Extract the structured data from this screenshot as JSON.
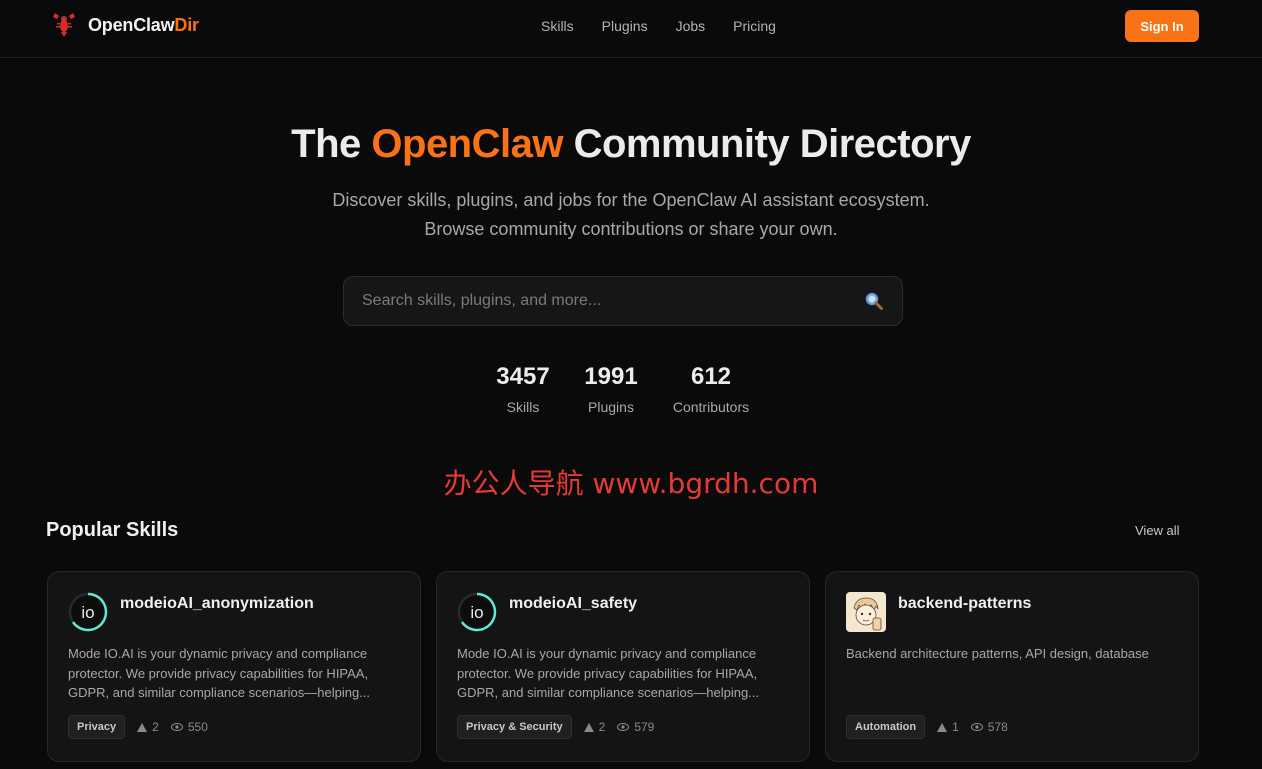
{
  "nav": {
    "brand_main": "OpenClaw",
    "brand_accent": "Dir",
    "brand_icon": "lobster-icon",
    "links": [
      "Skills",
      "Plugins",
      "Jobs",
      "Pricing"
    ],
    "signin_label": "Sign In"
  },
  "hero": {
    "title_prefix": "The ",
    "title_accent": "OpenClaw",
    "title_suffix": " Community Directory",
    "subtitle": "Discover skills, plugins, and jobs for the OpenClaw AI assistant ecosystem. Browse community contributions or share your own."
  },
  "search": {
    "placeholder": "Search skills, plugins, and more...",
    "value": "",
    "icon": "search-icon"
  },
  "stats": [
    {
      "value": "3457",
      "label": "Skills"
    },
    {
      "value": "1991",
      "label": "Plugins"
    },
    {
      "value": "612",
      "label": "Contributors"
    }
  ],
  "watermark": "办公人导航 www.bgrdh.com",
  "popular": {
    "title": "Popular Skills",
    "view_all": "View all",
    "cards": [
      {
        "name": "modeioAI_anonymization",
        "avatar": "io",
        "description": "Mode IO.AI is your dynamic privacy and compliance protector. We provide privacy capabilities for HIPAA, GDPR, and similar compliance scenarios—helping...",
        "tag": "Privacy",
        "votes": "2",
        "views": "550"
      },
      {
        "name": "modeioAI_safety",
        "avatar": "io",
        "description": "Mode IO.AI is your dynamic privacy and compliance protector. We provide privacy capabilities for HIPAA, GDPR, and similar compliance scenarios—helping...",
        "tag": "Privacy & Security",
        "votes": "2",
        "views": "579"
      },
      {
        "name": "backend-patterns",
        "avatar": "",
        "description": "Backend architecture patterns, API design, database",
        "tag": "Automation",
        "votes": "1",
        "views": "578"
      }
    ]
  },
  "colors": {
    "accent": "#f97316",
    "background": "#0a0a0a",
    "card": "#141414",
    "avatar_ring": "#5eead4",
    "watermark": "#e53935"
  }
}
